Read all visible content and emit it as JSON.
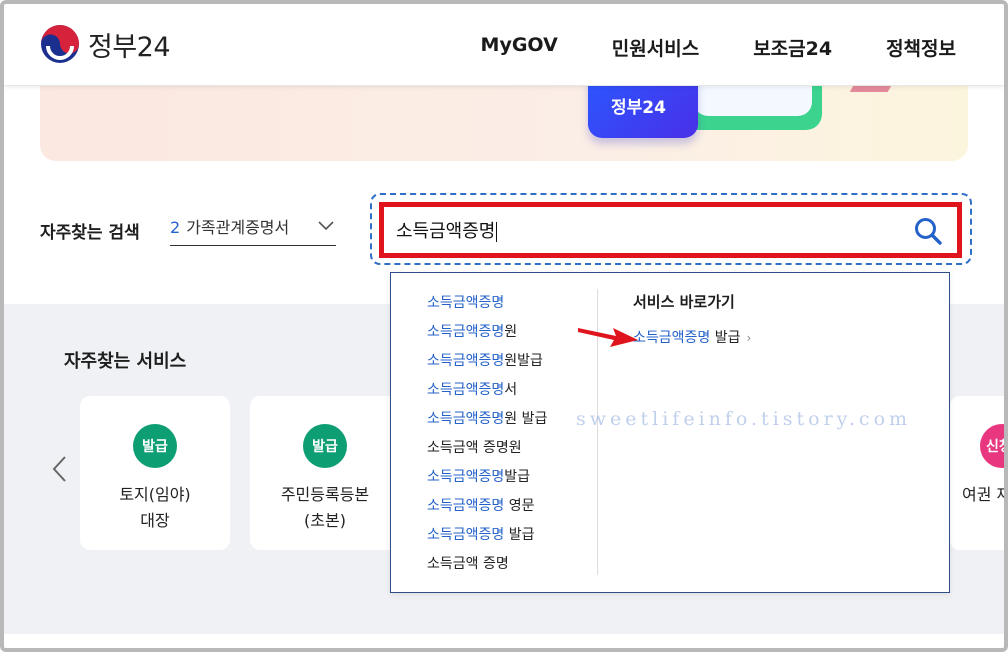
{
  "header": {
    "logo_text": "정부24",
    "nav": [
      "MyGOV",
      "민원서비스",
      "보조금24",
      "정책정보"
    ]
  },
  "banner": {
    "card_text": "정부24"
  },
  "search": {
    "label": "자주찾는 검색",
    "frequent": {
      "number": "2",
      "text": "가족관계증명서"
    },
    "value": "소득금액증명"
  },
  "suggestions": [
    {
      "hl": "소득금액증명",
      "rest": ""
    },
    {
      "hl": "소득금액증명",
      "rest": "원"
    },
    {
      "hl": "소득금액증명",
      "rest": "원발급"
    },
    {
      "hl": "소득금액증명",
      "rest": "서"
    },
    {
      "hl": "소득금액증명",
      "rest": "원 발급"
    },
    {
      "hl": "",
      "rest": "소득금액 증명원"
    },
    {
      "hl": "소득금액증명",
      "rest": "발급"
    },
    {
      "hl": "소득금액증명",
      "rest": " 영문"
    },
    {
      "hl": "소득금액증명",
      "rest": " 발급"
    },
    {
      "hl": "",
      "rest": "소득금액 증명"
    }
  ],
  "shortcut": {
    "title": "서비스 바로가기",
    "link_hl": "소득금액증명",
    "link_rest": " 발급",
    "chevron": "›"
  },
  "frequent_services": {
    "title": "자주찾는 서비스",
    "cards": [
      {
        "badge": "발급",
        "line1": "토지(임야)",
        "line2": "대장"
      },
      {
        "badge": "발급",
        "line1": "주민등록등본",
        "line2": "(초본)"
      }
    ],
    "partial_badge": "신청",
    "partial_name": "여권 재"
  },
  "watermark": "sweetlifeinfo.tistory.com",
  "colors": {
    "accent_blue": "#2462c9",
    "badge_green": "#0e9e73",
    "badge_pink": "#e8377f",
    "highlight_red": "#e0141c"
  }
}
